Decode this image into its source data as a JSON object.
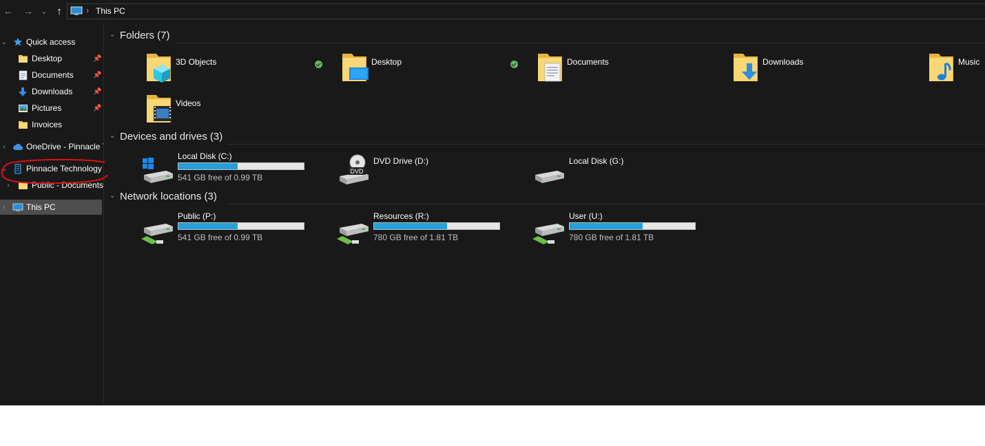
{
  "address_bar": {
    "location": "This PC",
    "separator": "›"
  },
  "nav_buttons": {
    "back": "←",
    "forward": "→",
    "recent": "⌄",
    "up": "↑"
  },
  "sidebar": {
    "quick_access": {
      "label": "Quick access"
    },
    "quick_items": [
      {
        "label": "Desktop",
        "icon": "folder-icon"
      },
      {
        "label": "Documents",
        "icon": "documents-icon"
      },
      {
        "label": "Downloads",
        "icon": "downloads-icon"
      },
      {
        "label": "Pictures",
        "icon": "pictures-icon"
      },
      {
        "label": "Invoices",
        "icon": "folder-icon"
      }
    ],
    "onedrive": {
      "label": "OneDrive - Pinnacle Technology"
    },
    "pinnacle": {
      "label": "Pinnacle Technology"
    },
    "public_docs": {
      "label": "Public - Documents"
    },
    "this_pc": {
      "label": "This PC"
    }
  },
  "groups": {
    "folders": "Folders (7)",
    "devices": "Devices and drives (3)",
    "network": "Network locations (3)"
  },
  "folders": [
    {
      "name": "3D Objects",
      "synced": true
    },
    {
      "name": "Desktop",
      "synced": true
    },
    {
      "name": "Documents",
      "synced": false
    },
    {
      "name": "Downloads",
      "synced": false
    },
    {
      "name": "Music",
      "synced": false
    },
    {
      "name": "Videos",
      "synced": false
    }
  ],
  "drives": [
    {
      "name": "Local Disk (C:)",
      "free": "541 GB free of 0.99 TB",
      "used_fraction": 0.47
    },
    {
      "name": "DVD Drive (D:)"
    },
    {
      "name": "Local Disk (G:)"
    }
  ],
  "network_locations": [
    {
      "name": "Public (P:)",
      "free": "541 GB free of 0.99 TB",
      "used_fraction": 0.47
    },
    {
      "name": "Resources (R:)",
      "free": "780 GB free of 1.81 TB",
      "used_fraction": 0.58
    },
    {
      "name": "User (U:)",
      "free": "780 GB free of 1.81 TB",
      "used_fraction": 0.58
    }
  ],
  "dvd_label": "DVD",
  "colors": {
    "background": "#191919",
    "usage_bar": "#26a0da",
    "annotation": "#e01010",
    "selected_row": "#4d4d4d"
  }
}
